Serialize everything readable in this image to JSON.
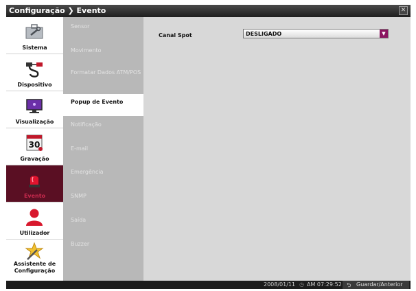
{
  "window": {
    "title": "Configuração ❯ Evento",
    "close_glyph": "✕"
  },
  "sidebar": {
    "items": [
      {
        "label": "Sistema",
        "icon": "toolbox-icon"
      },
      {
        "label": "Dispositivo",
        "icon": "cable-icon"
      },
      {
        "label": "Visualização",
        "icon": "monitor-icon"
      },
      {
        "label": "Gravação",
        "icon": "calendar-icon",
        "icon_text": "30"
      },
      {
        "label": "Evento",
        "icon": "siren-icon",
        "active": true
      },
      {
        "label": "Utilizador",
        "icon": "user-icon"
      },
      {
        "label": "Assistente de Configuração",
        "icon": "wizard-icon"
      }
    ]
  },
  "submenu": {
    "items": [
      {
        "label": "Sensor"
      },
      {
        "label": "Movimento"
      },
      {
        "label": "Formatar Dados ATM/POS"
      },
      {
        "label": "Popup de Evento",
        "active": true
      },
      {
        "label": "Notificação"
      },
      {
        "label": "E-mail"
      },
      {
        "label": "Emergência"
      },
      {
        "label": "SNMP"
      },
      {
        "label": "Saída"
      },
      {
        "label": "Buzzer"
      }
    ]
  },
  "content": {
    "canal_spot": {
      "label": "Canal Spot",
      "value": "DESLIGADO"
    }
  },
  "statusbar": {
    "date": "2008/01/11",
    "time": "AM 07:29:52",
    "save_button": "Guardar/Anterior"
  },
  "colors": {
    "accent": "#8a1660",
    "active_nav_bg": "#5a0f23",
    "submenu_bg": "#b8b8b8",
    "content_bg": "#d8d8d8"
  }
}
